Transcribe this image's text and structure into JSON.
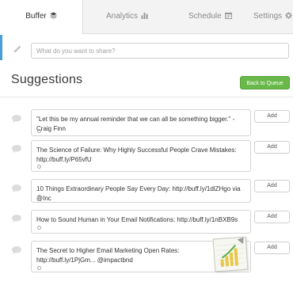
{
  "tabs": {
    "buffer": "Buffer",
    "analytics": "Analytics",
    "schedule": "Schedule",
    "settings": "Settings"
  },
  "composer": {
    "placeholder": "What do you want to share?"
  },
  "page_title": "Suggestions",
  "back_button": "Back to Queue",
  "add_label": "Add",
  "suggestions": [
    {
      "text": "\"Let this be my annual reminder that we can all be something bigger.\" - Craig Finn"
    },
    {
      "text": "The Science of Failure: Why Highly Successful People Crave Mistakes: http://buff.ly/P65vfU"
    },
    {
      "text": "10 Things Extraordinary People Say Every Day: http://buff.ly/1dlZHgo via @Inc"
    },
    {
      "text": "How to Sound Human in Your Email Notifications: http://buff.ly/1nBXB9s"
    },
    {
      "text": "The Secret to Higher Email Marketing Open Rates: http://buff.ly/1PjGm... @impactbnd"
    }
  ],
  "colors": {
    "accent_green": "#69b84a",
    "accent_blue": "#4a9fd8"
  },
  "icons": [
    "layers-icon",
    "bar-chart-icon",
    "calendar-icon",
    "gear-icon",
    "pencil-icon",
    "comment-icon",
    "clock-icon",
    "sticker-chart-icon"
  ]
}
